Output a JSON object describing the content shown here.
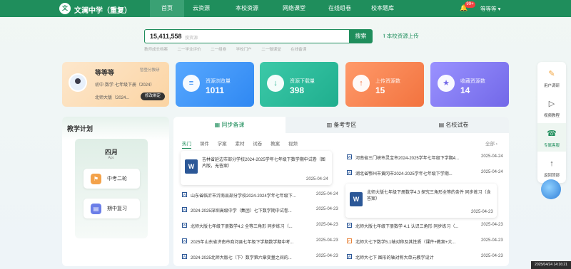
{
  "header": {
    "logo": "文",
    "school_name": "文澜中学（重复）",
    "nav": [
      "首页",
      "云资源",
      "本校资源",
      "网络课堂",
      "在线组卷",
      "校本题库"
    ],
    "notification_count": "99+",
    "user_name": "等等等 ▾"
  },
  "search": {
    "count": "15,411,558",
    "placeholder": "搜资源",
    "button_label": "搜索",
    "upload_label": "本校资源上传"
  },
  "quick_links": [
    "教师成长档案",
    "二一学业评价",
    "二一组卷",
    "学校门户",
    "二一微课堂",
    "在线备课"
  ],
  "user_card": {
    "name": "等等等",
    "switch_role": "暂登分教研",
    "grade": "初中·数学·七年级下册（2024）",
    "edition": "北师大版（2024...",
    "edit_button": "修改绑定"
  },
  "stats": [
    {
      "label": "资源浏览量",
      "value": "1011",
      "icon": "document-icon",
      "color": "#2f88f2"
    },
    {
      "label": "资源下载量",
      "value": "398",
      "icon": "download-icon",
      "color": "#1fae8e"
    },
    {
      "label": "上传资源数",
      "value": "15",
      "icon": "upload-icon",
      "color": "#f2733f"
    },
    {
      "label": "收藏资源数",
      "value": "14",
      "icon": "star-icon",
      "color": "#7268e8"
    }
  ],
  "plan": {
    "title": "教学计划",
    "month": "四月",
    "month_en": "Apr.",
    "items": [
      "中考二轮",
      "期中复习"
    ]
  },
  "content": {
    "tabs": [
      "同步备课",
      "备考专区",
      "名校试卷"
    ],
    "subtabs": [
      "热门",
      "课件",
      "学案",
      "素材",
      "试卷",
      "教案",
      "视频"
    ],
    "all_label": "全部 ›",
    "left_featured": {
      "title": "吉林省延边市部分学校2024-2025学年七年级下数学期中试卷（图片版，无答案）",
      "date": "2025-04-24"
    },
    "left_rows": [
      {
        "title": "山东省临沂市沂南县部分学校2024-2024学年七年级下...",
        "date": "2025-04-24"
      },
      {
        "title": "2024-2025深圳高级中学（集团）七下数学期中试卷...",
        "date": "2025-04-23"
      },
      {
        "title": "北师大版七年级下册数学4.2 全等三角形 同步练习（...",
        "date": "2025-04-23"
      },
      {
        "title": "2025年山东省济南市商河县七年级下学期数学期中考...",
        "date": "2025-04-23"
      },
      {
        "title": "2024-2025北师大版七（下）数学第六章变量之间的...",
        "date": "2025-04-23"
      }
    ],
    "right_rows_top": [
      {
        "title": "河南省三门峡市灵宝市2024-2025学年七年级下学期4...",
        "date": "2025-04-24"
      },
      {
        "title": "湖北省鄂州市黄冈市2024-2025学年七年级下学期...",
        "date": "2025-04-24"
      }
    ],
    "right_featured": {
      "title": "北师大版七年级下册数学4.3 探究三角形全等的条件 同步练习（含答案）",
      "date": "2025-04-23"
    },
    "right_rows_bottom": [
      {
        "title": "北师大版七年级下册数学 4.1 认识三角形 同步练习（...",
        "date": "2025-04-23"
      },
      {
        "title": "北师大七下数学5.1轴对称及其性质（课件+教案+大...",
        "date": "2025-04-23",
        "pdf": true
      },
      {
        "title": "北师大七下 图形的轴对称大单元教学设计",
        "date": "2025-04-23"
      }
    ]
  },
  "sidebar": [
    {
      "label": "用户调研",
      "icon": "survey-icon"
    },
    {
      "label": "视频教程",
      "icon": "video-icon"
    },
    {
      "label": "专属客服",
      "icon": "headset-icon"
    },
    {
      "label": "返回顶部",
      "icon": "arrow-up-icon"
    }
  ],
  "clock": "2025/04/24 14:16:21"
}
